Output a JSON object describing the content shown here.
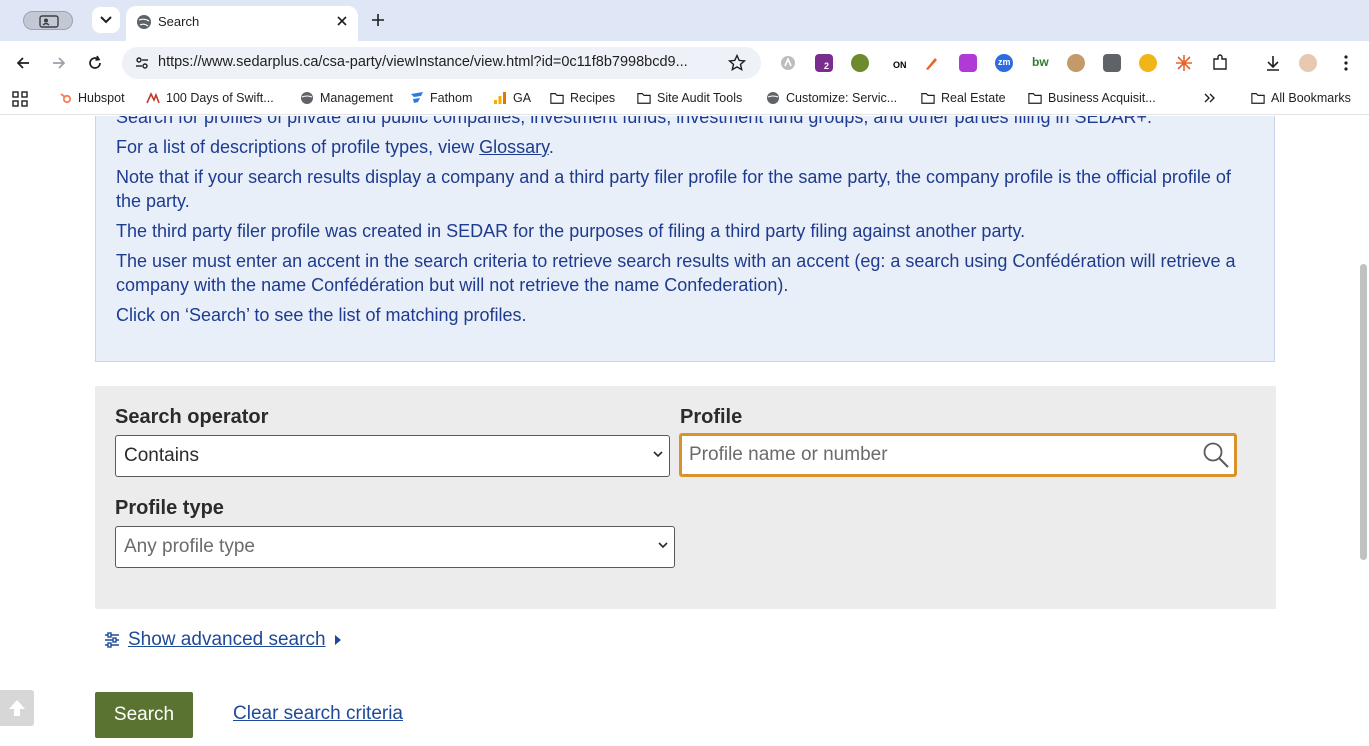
{
  "browser": {
    "tab_title": "Search",
    "url": "https://www.sedarplus.ca/csa-party/viewInstance/view.html?id=0c11f8b7998bcd9...",
    "bookmarks": [
      {
        "label": "Hubspot",
        "icon": "hubspot-icon"
      },
      {
        "label": "100 Days of Swift...",
        "icon": "swift-icon"
      },
      {
        "label": "Management",
        "icon": "globe-icon"
      },
      {
        "label": "Fathom",
        "icon": "fathom-icon"
      },
      {
        "label": "GA",
        "icon": "analytics-icon"
      },
      {
        "label": "Recipes",
        "icon": "folder-icon"
      },
      {
        "label": "Site Audit Tools",
        "icon": "folder-icon"
      },
      {
        "label": "Customize: Servic...",
        "icon": "globe-icon"
      },
      {
        "label": "Real Estate",
        "icon": "folder-icon"
      },
      {
        "label": "Business Acquisit...",
        "icon": "folder-icon"
      }
    ],
    "all_bookmarks": "All Bookmarks",
    "extension_badge": "2",
    "extension_on": "ON",
    "extension_zm": "zm",
    "extension_bw": "bw"
  },
  "info": {
    "line1": "Search for profiles of private and public companies, investment funds, investment fund groups, and other parties filing in SEDAR+.",
    "line2_prefix": "For a list of descriptions of profile types, view ",
    "line2_link": "Glossary",
    "line2_suffix": ".",
    "line3": "Note that if your search results display a company and a third party filer profile for the same party, the company profile is the official profile of the party.",
    "line4": "The third party filer profile was created in SEDAR for the purposes of filing a third party filing against another party.",
    "line5": "The user must enter an accent in the search criteria to retrieve search results with an accent (eg: a search using Confédération will retrieve a company with the name Confédération but will not retrieve the name Confederation).",
    "line6": "Click on ‘Search’ to see the list of matching profiles."
  },
  "form": {
    "operator_label": "Search operator",
    "operator_value": "Contains",
    "profile_label": "Profile",
    "profile_placeholder": "Profile name or number",
    "profile_type_label": "Profile type",
    "profile_type_value": "Any profile type",
    "advanced_label": "Show advanced search",
    "search_button": "Search",
    "clear_link": "Clear search criteria"
  },
  "colors": {
    "accent_blue": "#1e3b8f",
    "focus_orange": "#d9932a",
    "button_green": "#5a7330",
    "info_bg": "#e8eff8"
  }
}
